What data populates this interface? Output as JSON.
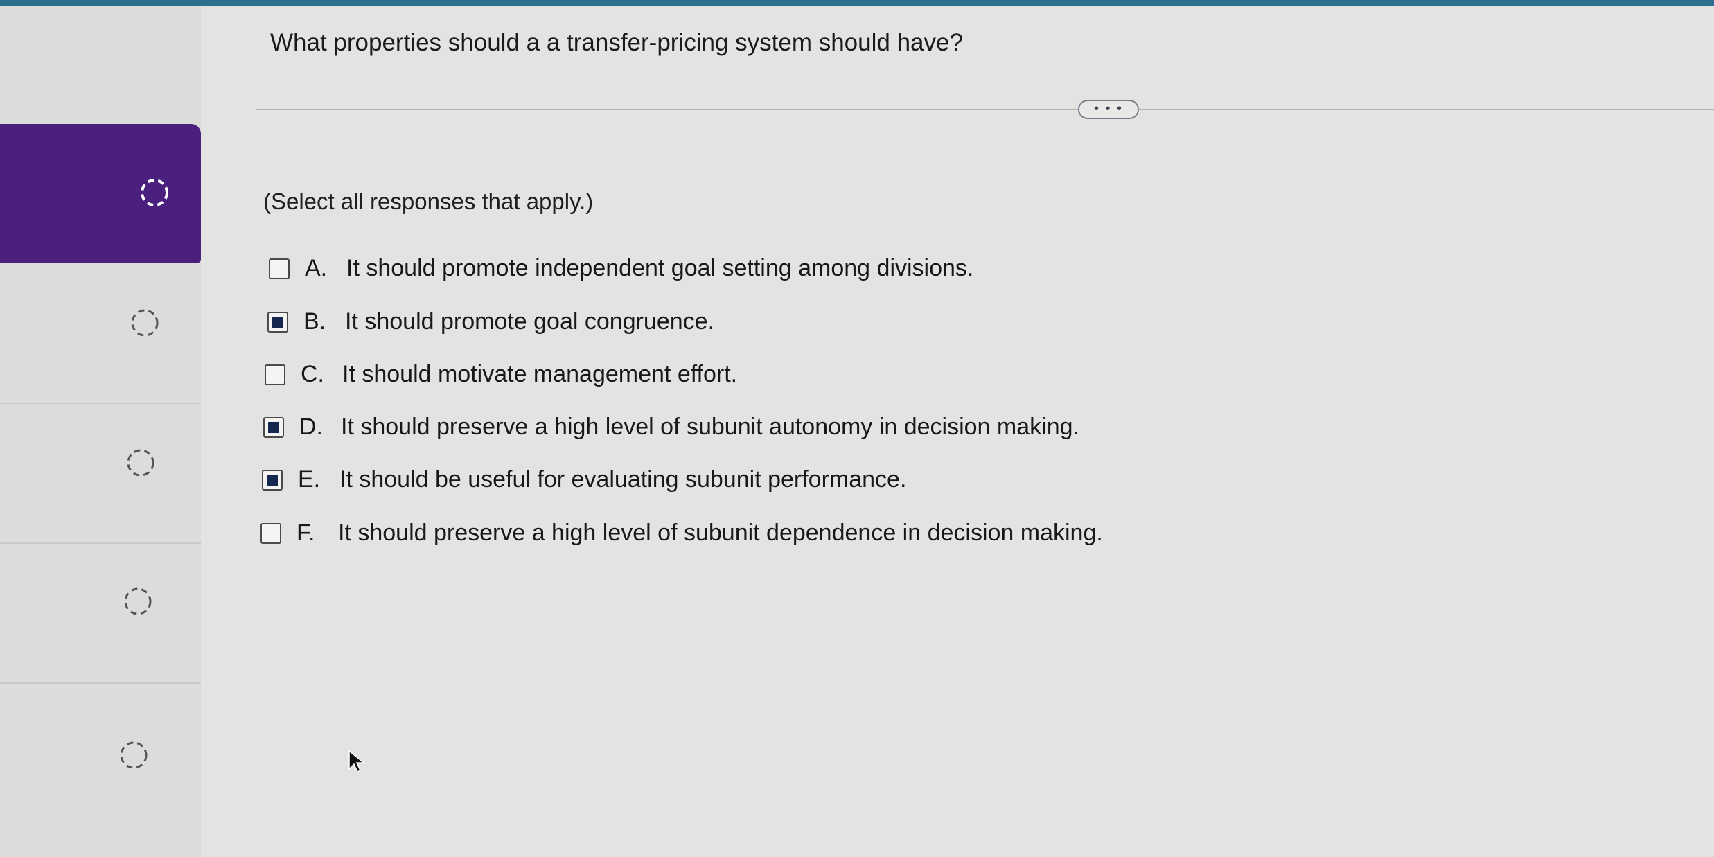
{
  "question": {
    "text": "What properties should a a transfer-pricing system should have?"
  },
  "more_button": {
    "label": "• • •"
  },
  "instruction": "(Select all responses that apply.)",
  "options": [
    {
      "letter": "A.",
      "text": "It should promote independent goal setting among divisions.",
      "checked": false
    },
    {
      "letter": "B.",
      "text": "It should promote goal congruence.",
      "checked": true
    },
    {
      "letter": "C.",
      "text": "It should motivate management effort.",
      "checked": false
    },
    {
      "letter": "D.",
      "text": "It should preserve a high level of subunit autonomy in decision making.",
      "checked": true
    },
    {
      "letter": "E.",
      "text": "It should be useful for evaluating subunit performance.",
      "checked": true
    },
    {
      "letter": "F.",
      "text": "It should preserve a high level of subunit dependence in decision making.",
      "checked": false
    }
  ],
  "sidebar": {
    "items": [
      {
        "status": "in-progress-icon",
        "active": true
      },
      {
        "status": "not-started-icon",
        "active": false
      },
      {
        "status": "not-started-icon",
        "active": false
      },
      {
        "status": "not-started-icon",
        "active": false
      },
      {
        "status": "not-started-icon",
        "active": false
      }
    ]
  },
  "colors": {
    "accent": "#4b1f7e",
    "top_bar": "#2d6f8e",
    "checked_fill": "#14284f"
  }
}
